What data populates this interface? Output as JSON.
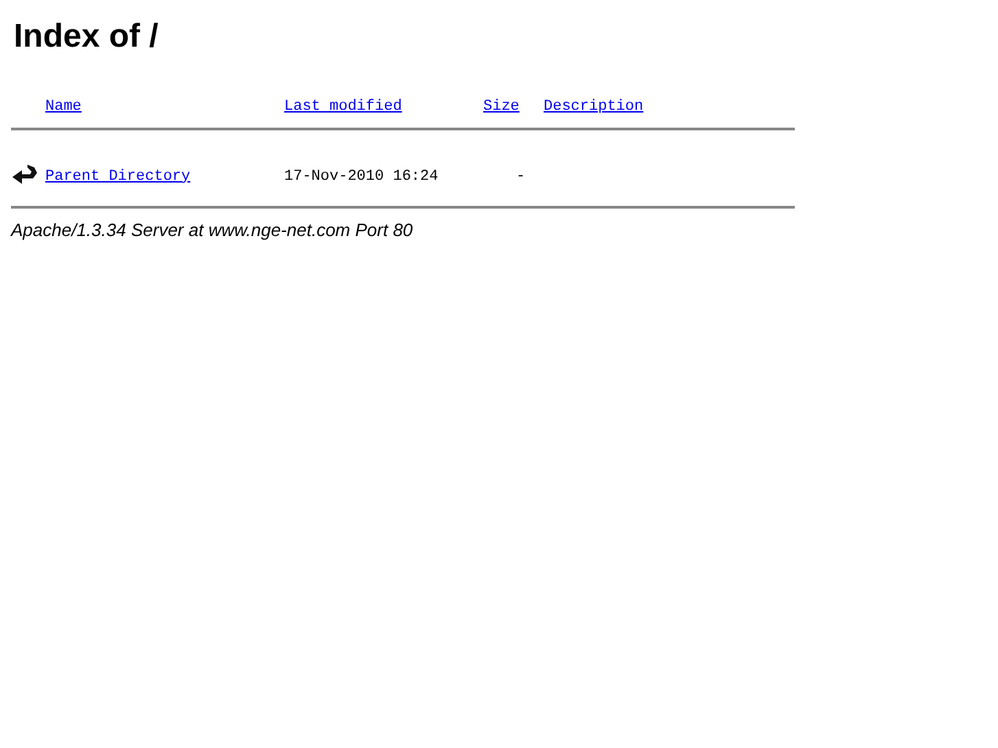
{
  "title": "Index of /",
  "columns": [
    "Name",
    "Last modified",
    "Size",
    "Description"
  ],
  "rows": [
    {
      "name": "Parent Directory",
      "modified": "17-Nov-2010 16:24",
      "size": "-"
    }
  ],
  "footer": "Apache/1.3.34 Server at www.nge-net.com Port 80"
}
